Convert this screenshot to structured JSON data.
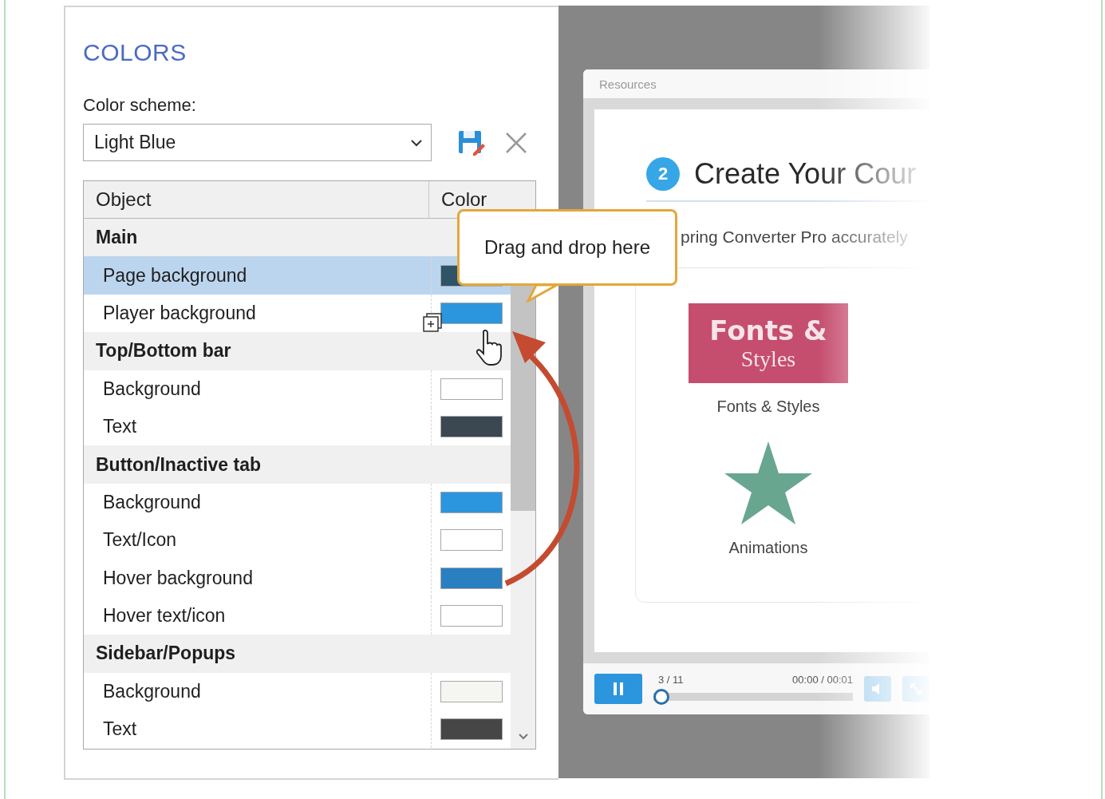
{
  "panel": {
    "title": "COLORS",
    "scheme_label": "Color scheme:",
    "scheme_value": "Light Blue"
  },
  "table": {
    "columns": [
      "Object",
      "Color"
    ],
    "rows": [
      {
        "kind": "group",
        "label": "Main"
      },
      {
        "kind": "item",
        "label": "Page background",
        "selected": true,
        "color": "#2f5368"
      },
      {
        "kind": "item",
        "label": "Player background",
        "selected": false,
        "color": "#2b95de"
      },
      {
        "kind": "group",
        "label": "Top/Bottom bar"
      },
      {
        "kind": "item",
        "label": "Background",
        "selected": false,
        "color": "#ffffff"
      },
      {
        "kind": "item",
        "label": "Text",
        "selected": false,
        "color": "#3b4852"
      },
      {
        "kind": "group",
        "label": "Button/Inactive tab"
      },
      {
        "kind": "item",
        "label": "Background",
        "selected": false,
        "color": "#2b95de"
      },
      {
        "kind": "item",
        "label": "Text/Icon",
        "selected": false,
        "color": "#ffffff"
      },
      {
        "kind": "item",
        "label": "Hover background",
        "selected": false,
        "color": "#2a7fc0"
      },
      {
        "kind": "item",
        "label": "Hover text/icon",
        "selected": false,
        "color": "#ffffff"
      },
      {
        "kind": "group",
        "label": "Sidebar/Popups"
      },
      {
        "kind": "item",
        "label": "Background",
        "selected": false,
        "color": "#f5f5f2"
      },
      {
        "kind": "item",
        "label": "Text",
        "selected": false,
        "color": "#464646"
      }
    ]
  },
  "callout": {
    "text": "Drag and drop here"
  },
  "preview": {
    "tab": "Resources",
    "step": "2",
    "heading": "Create Your Cour",
    "subtitle": "pring Converter Pro accurately",
    "thumbnail": {
      "title": "Fonts &",
      "subtitle": "Styles"
    },
    "cards": [
      {
        "kind": "thumbnail",
        "label": "Fonts & Styles"
      },
      {
        "kind": "star",
        "label": "Animations"
      }
    ],
    "player": {
      "slide_counter": "3 / 11",
      "time": "00:00 / 00:01",
      "progress": {
        "level": 0
      }
    }
  }
}
